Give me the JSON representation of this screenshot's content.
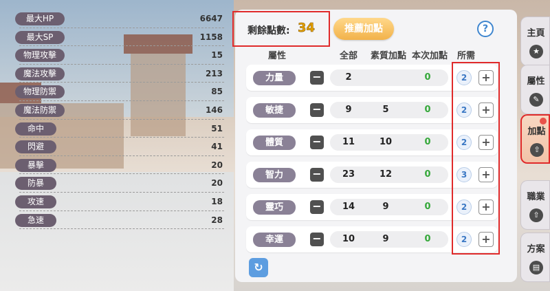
{
  "stats": [
    {
      "label": "最大HP",
      "value": "6647"
    },
    {
      "label": "最大SP",
      "value": "1158"
    },
    {
      "label": "物理攻擊",
      "value": "15"
    },
    {
      "label": "魔法攻擊",
      "value": "213"
    },
    {
      "label": "物理防禦",
      "value": "85"
    },
    {
      "label": "魔法防禦",
      "value": "146"
    },
    {
      "label": "命中",
      "value": "51"
    },
    {
      "label": "閃避",
      "value": "41"
    },
    {
      "label": "暴擊",
      "value": "20"
    },
    {
      "label": "防暴",
      "value": "20"
    },
    {
      "label": "攻速",
      "value": "18"
    },
    {
      "label": "急速",
      "value": "28"
    }
  ],
  "remaining": {
    "label": "剩餘點數:",
    "value": "34"
  },
  "recommend_label": "推薦加點",
  "help_label": "?",
  "headers": {
    "attr": "屬性",
    "total": "全部",
    "base": "素質加點",
    "current": "本次加點",
    "need": "所需"
  },
  "attributes": [
    {
      "name": "力量",
      "total": "2",
      "base": "",
      "current": "0",
      "need": "2"
    },
    {
      "name": "敏捷",
      "total": "9",
      "base": "5",
      "current": "0",
      "need": "2"
    },
    {
      "name": "體質",
      "total": "11",
      "base": "10",
      "current": "0",
      "need": "2"
    },
    {
      "name": "智力",
      "total": "23",
      "base": "12",
      "current": "0",
      "need": "3"
    },
    {
      "name": "靈巧",
      "total": "14",
      "base": "9",
      "current": "0",
      "need": "2"
    },
    {
      "name": "幸運",
      "total": "10",
      "base": "9",
      "current": "0",
      "need": "2"
    }
  ],
  "minus_glyph": "−",
  "plus_glyph": "+",
  "reset_icon": "refresh-icon",
  "tabs": [
    {
      "label": "主頁",
      "icon": "star-icon",
      "glyph": "★"
    },
    {
      "label": "屬性",
      "icon": "pencil-icon",
      "glyph": "✎"
    },
    {
      "label": "加點",
      "icon": "upgrade-arrow-icon",
      "glyph": "⇧"
    },
    {
      "label": "職業",
      "icon": "upgrade-arrow-icon",
      "glyph": "⇧"
    },
    {
      "label": "方案",
      "icon": "document-icon",
      "glyph": "▤"
    }
  ],
  "colors": {
    "highlight": "#e02a2a",
    "remaining_value": "#e6a100",
    "green": "#35a83a"
  }
}
